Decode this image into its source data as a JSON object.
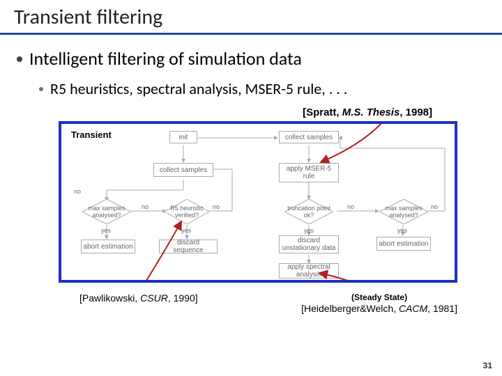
{
  "title": "Transient filtering",
  "bullet1": "Intelligent filtering of simulation data",
  "bullet2": "R5 heuristics, spectral analysis, MSER-5 rule, . . .",
  "cite_top": {
    "author": "[Spratt, ",
    "ital": "M.S. Thesis",
    "tail": ", 1998]"
  },
  "transient_label": "Transient",
  "flow": {
    "init": "init",
    "collect_samples": "collect samples",
    "apply_mser5": "apply MSER-5 rule",
    "max_samples": "max samples analysed?",
    "r5_verified": "R5 heuristic verified?",
    "trunc_ok": "truncation point ok?",
    "max_samples2": "max samples analysed?",
    "abort1": "abort estimation",
    "discard_seq": "discard sequence",
    "discard_unstat": "discard unstationary data",
    "abort2": "abort estimation",
    "apply_spectral": "apply spectral analysis",
    "no": "no",
    "yes": "yes"
  },
  "cite_left": {
    "pre": "[Pawlikowski, ",
    "ital": "CSUR",
    "tail": ", 1990]"
  },
  "cite_right_steady": "(Steady State)",
  "cite_right": {
    "pre": "[Heidelberger&Welch, ",
    "ital": "CACM",
    "tail": ", 1981]"
  },
  "pagenum": "31"
}
